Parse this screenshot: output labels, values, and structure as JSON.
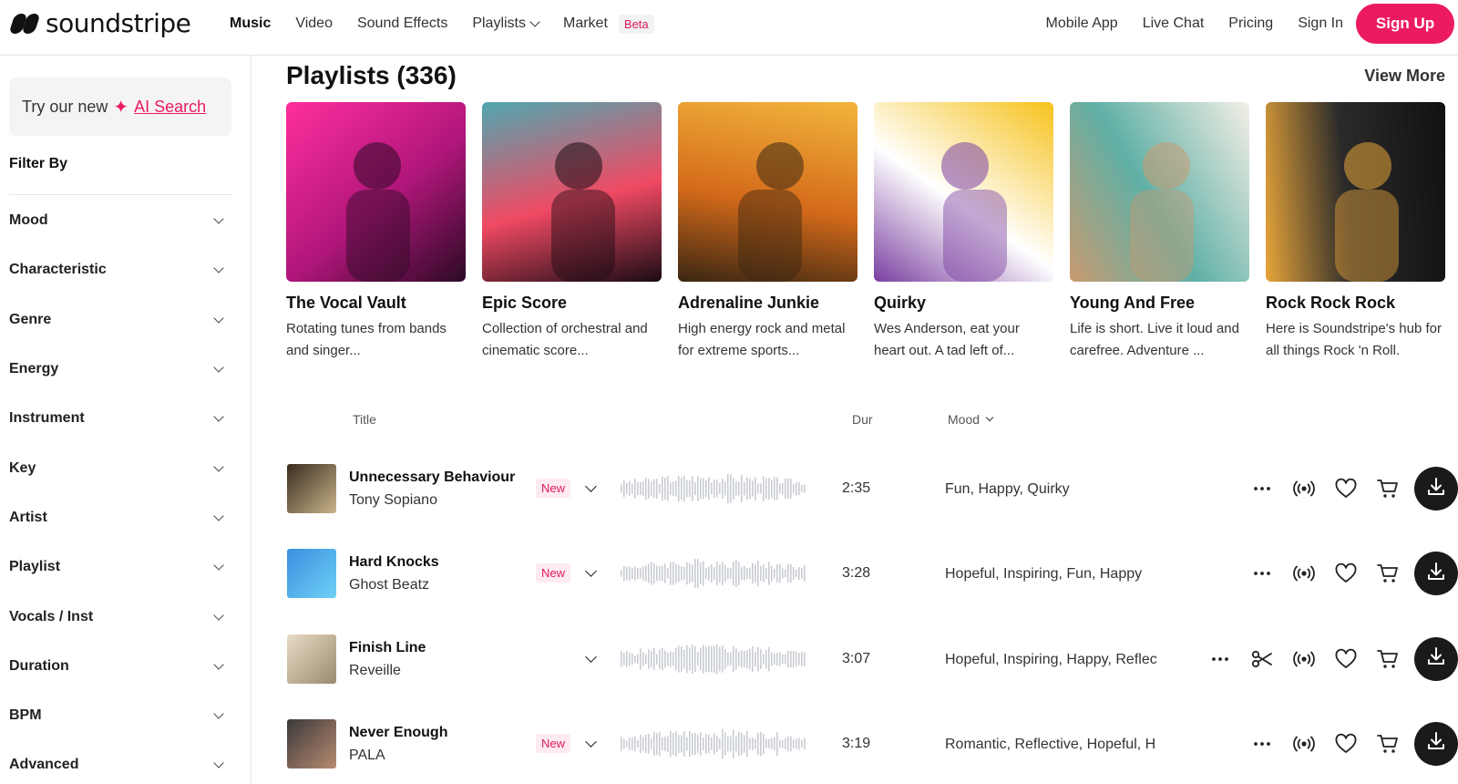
{
  "header": {
    "logo_text": "soundstripe",
    "nav": [
      {
        "label": "Music",
        "active": true
      },
      {
        "label": "Video"
      },
      {
        "label": "Sound Effects"
      },
      {
        "label": "Playlists",
        "dropdown": true
      },
      {
        "label": "Market",
        "badge": "Beta"
      }
    ],
    "right_links": [
      "Mobile App",
      "Live Chat",
      "Pricing",
      "Sign In"
    ],
    "signup_label": "Sign Up",
    "brand_color": "#ec1a63"
  },
  "sidebar": {
    "ai_prefix": "Try our new",
    "ai_link": "AI Search",
    "filter_title": "Filter By",
    "filters": [
      "Mood",
      "Characteristic",
      "Genre",
      "Energy",
      "Instrument",
      "Key",
      "Artist",
      "Playlist",
      "Vocals / Inst",
      "Duration",
      "BPM",
      "Advanced"
    ]
  },
  "playlists": {
    "heading": "Playlists (336)",
    "view_more": "View More",
    "cards": [
      {
        "title": "The Vocal Vault",
        "desc": "Rotating tunes from bands and singer...",
        "palette": [
          "#ff2f9e",
          "#b0167a",
          "#2b0a24"
        ]
      },
      {
        "title": "Epic Score",
        "desc": "Collection of orchestral and cinematic score...",
        "palette": [
          "#4fa7b0",
          "#f04a63",
          "#1a0b14"
        ]
      },
      {
        "title": "Adrenaline Junkie",
        "desc": "High energy rock and metal for extreme sports...",
        "palette": [
          "#f2b53c",
          "#d46a1a",
          "#3a2612"
        ]
      },
      {
        "title": "Quirky",
        "desc": "Wes Anderson, eat your heart out. A tad left of...",
        "palette": [
          "#f6c21b",
          "#ffffff",
          "#7a3fa0"
        ]
      },
      {
        "title": "Young And Free",
        "desc": "Life is short. Live it loud and carefree. Adventure ...",
        "palette": [
          "#f4efe6",
          "#5fb0a6",
          "#c89a70"
        ]
      },
      {
        "title": "Rock Rock Rock",
        "desc": "Here is Soundstripe's hub for all things Rock 'n Roll.",
        "palette": [
          "#111111",
          "#2a2a2a",
          "#e8a53a"
        ]
      }
    ]
  },
  "table": {
    "headers": {
      "title": "Title",
      "dur": "Dur",
      "mood": "Mood"
    },
    "tracks": [
      {
        "name": "Unnecessary Behaviour",
        "artist": "Tony Sopiano",
        "badge": "New",
        "duration": "2:35",
        "mood": "Fun, Happy, Quirky",
        "scissors": false,
        "thumb": [
          "#3a2c1f",
          "#c9b48a"
        ]
      },
      {
        "name": "Hard Knocks",
        "artist": "Ghost Beatz",
        "badge": "New",
        "duration": "3:28",
        "mood": "Hopeful, Inspiring, Fun, Happy",
        "scissors": false,
        "thumb": [
          "#3a8fe0",
          "#6fd0f5"
        ]
      },
      {
        "name": "Finish Line",
        "artist": "Reveille",
        "badge": "",
        "duration": "3:07",
        "mood": "Hopeful, Inspiring, Happy, Reflec",
        "scissors": true,
        "thumb": [
          "#e8dcc4",
          "#9a8a70"
        ]
      },
      {
        "name": "Never Enough",
        "artist": "PALA",
        "badge": "New",
        "duration": "3:19",
        "mood": "Romantic, Reflective, Hopeful, H",
        "scissors": false,
        "thumb": [
          "#3a3a3a",
          "#b88a70"
        ]
      }
    ]
  }
}
